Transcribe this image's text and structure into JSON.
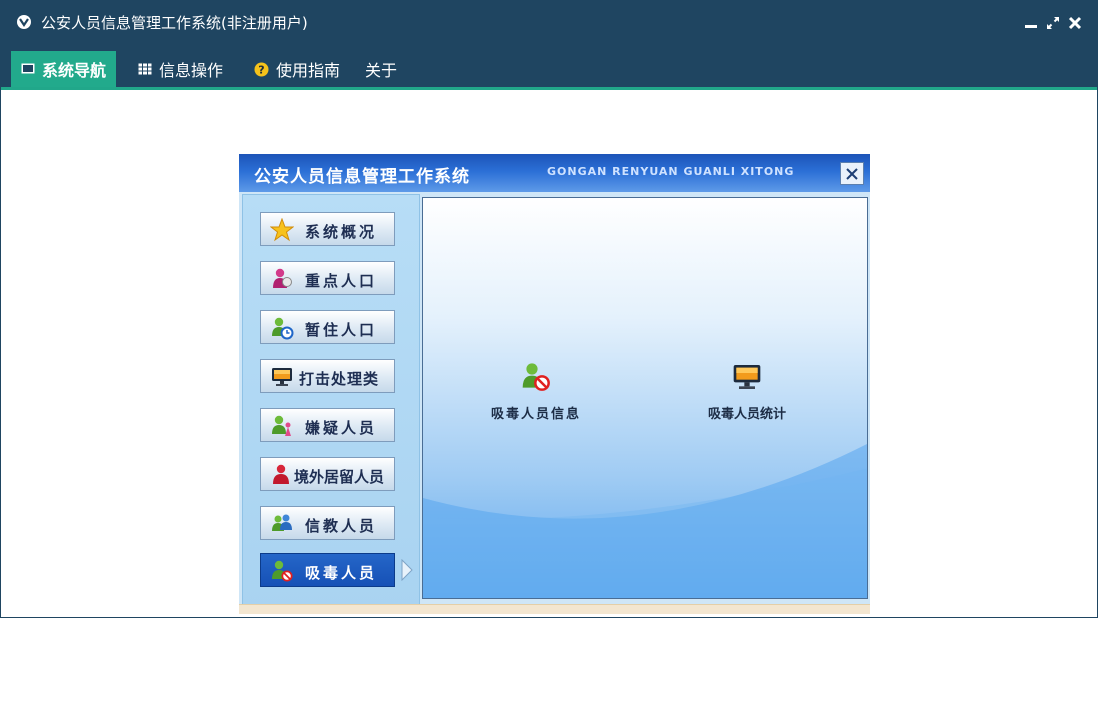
{
  "window": {
    "title": "公安人员信息管理工作系统(非注册用户)",
    "controls": [
      "minimize-icon",
      "restore-icon",
      "close-icon"
    ]
  },
  "menu": {
    "items": [
      {
        "label": "系统导航",
        "icon": "monitor-icon",
        "active": true
      },
      {
        "label": "信息操作",
        "icon": "grid-icon",
        "active": false
      },
      {
        "label": "使用指南",
        "icon": "help-icon",
        "active": false
      },
      {
        "label": "关于",
        "icon": "",
        "active": false
      }
    ]
  },
  "app": {
    "title": "公安人员信息管理工作系统",
    "subtitle": "GONGAN RENYUAN GUANLI XITONG",
    "sidebar": [
      {
        "label": "系统概况",
        "icon": "star-icon"
      },
      {
        "label": "重点人口",
        "icon": "person-pink-icon"
      },
      {
        "label": "暂住人口",
        "icon": "person-clock-icon"
      },
      {
        "label": "打击处理类",
        "icon": "monitor-icon"
      },
      {
        "label": "嫌疑人员",
        "icon": "person-suspect-icon"
      },
      {
        "label": "境外居留人员",
        "icon": "person-red-icon"
      },
      {
        "label": "信教人员",
        "icon": "people-icon"
      },
      {
        "label": "吸毒人员",
        "icon": "person-forbidden-icon",
        "active": true
      }
    ],
    "features": [
      {
        "label": "吸毒人员信息",
        "icon": "person-forbidden-icon"
      },
      {
        "label": "吸毒人员统计",
        "icon": "monitor-icon"
      }
    ]
  },
  "colors": {
    "titlebar": "#1f4561",
    "accent": "#22aa8c",
    "app_header": "#2b6fd6",
    "active_sidebar": "#1f5cc1"
  }
}
